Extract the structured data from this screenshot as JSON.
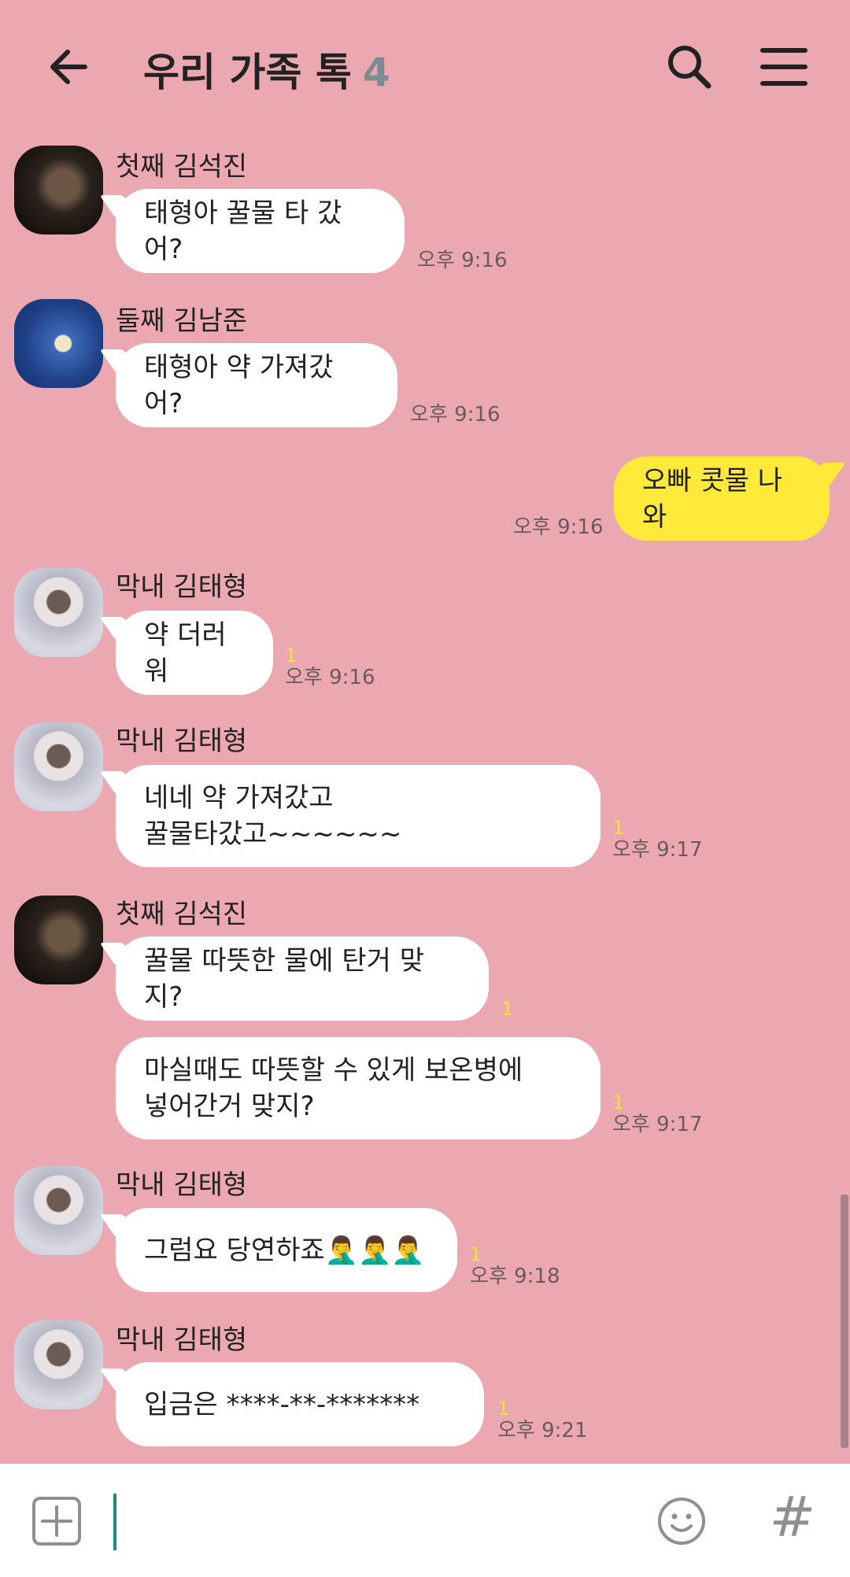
{
  "header": {
    "title": "우리 가족 톡",
    "member_count": "4",
    "icons": {
      "back": "arrow-left-icon",
      "search": "search-icon",
      "menu": "hamburger-menu-icon"
    }
  },
  "messages": [
    {
      "type": "incoming",
      "sender": "첫째 김석진",
      "avatar": "jin",
      "text": "태형아 꿀물 타 갔어?",
      "unread": "",
      "time": "오후 9:16"
    },
    {
      "type": "incoming",
      "sender": "둘째 김남준",
      "avatar": "rm",
      "text": "태형아 약 가져갔어?",
      "unread": "",
      "time": "오후 9:16"
    },
    {
      "type": "outgoing",
      "text": "오빠 콧물 나와",
      "time": "오후 9:16"
    },
    {
      "type": "incoming",
      "sender": "막내 김태형",
      "avatar": "v",
      "text": "약 더러워",
      "unread": "1",
      "time": "오후 9:16"
    },
    {
      "type": "incoming",
      "sender": "막내 김태형",
      "avatar": "v",
      "text": "네네 약 가져갔고\n꿀물타갔고~~~~~~",
      "unread": "1",
      "time": "오후 9:17"
    },
    {
      "type": "incoming",
      "sender": "첫째 김석진",
      "avatar": "jin",
      "text": "꿀물 따뜻한 물에 탄거 맞지?",
      "unread": "1",
      "time": ""
    },
    {
      "type": "incoming-cont",
      "text": "마실때도 따뜻할 수 있게 보온병에\n넣어간거 맞지?",
      "unread": "1",
      "time": "오후 9:17"
    },
    {
      "type": "incoming",
      "sender": "막내 김태형",
      "avatar": "v",
      "text": "그럼요 당연하죠🤦‍♂️🤦‍♂️🤦‍♂️",
      "unread": "1",
      "time": "오후 9:18"
    },
    {
      "type": "incoming",
      "sender": "막내 김태형",
      "avatar": "v",
      "text": "입금은 ****-**-*******",
      "unread": "1",
      "time": "오후 9:21"
    }
  ],
  "input": {
    "value": "",
    "icons": {
      "plus": "plus-square-icon",
      "emoji": "smiley-face-icon",
      "hash": "#"
    }
  }
}
